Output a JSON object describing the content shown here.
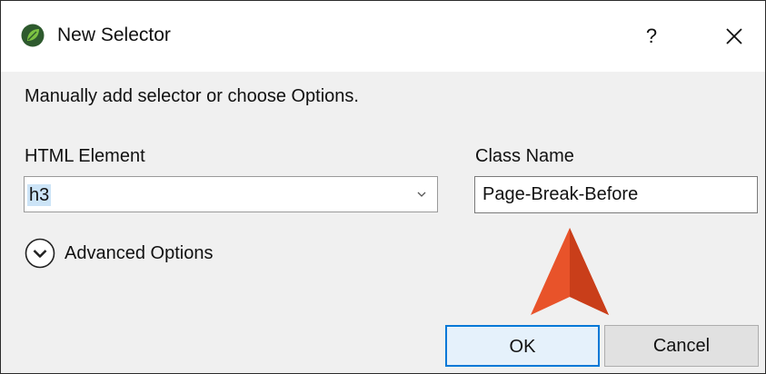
{
  "window": {
    "title": "New Selector",
    "help_glyph": "?",
    "close_glyph": "close-icon"
  },
  "instruction": "Manually add selector or choose Options.",
  "html_element": {
    "label": "HTML Element",
    "value": "h3"
  },
  "class_name": {
    "label": "Class Name",
    "value": "Page-Break-Before"
  },
  "advanced": {
    "label": "Advanced Options",
    "icon": "chevron-down-circle-icon"
  },
  "buttons": {
    "ok": "OK",
    "cancel": "Cancel"
  },
  "colors": {
    "accent": "#0078d7",
    "arrow": "#e8532a",
    "selection": "#cce4f7"
  }
}
